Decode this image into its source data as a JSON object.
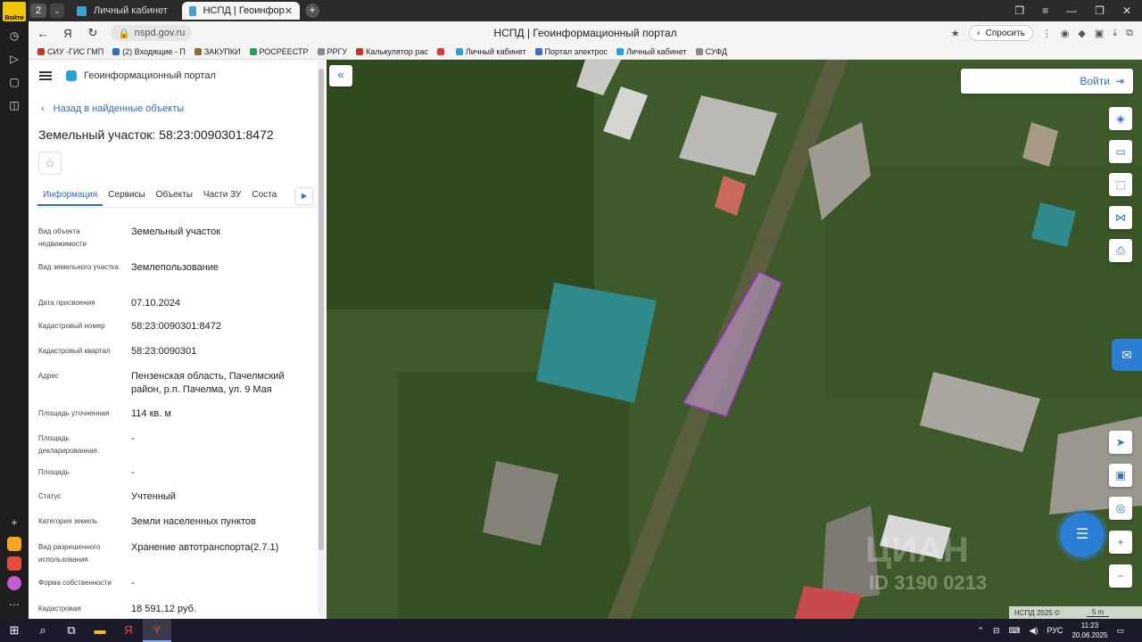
{
  "browser": {
    "rail_badge": "Войти",
    "tab_count": "2",
    "tabs": [
      {
        "label": "Личный кабинет"
      },
      {
        "label": "НСПД | Геоинформационі"
      }
    ],
    "url": "nspd.gov.ru",
    "page_title": "НСПД | Геоинформационный портал",
    "ask_label": "Спросить",
    "bookmarks": [
      {
        "label": "СИУ -ГИС ГМП",
        "color": "#c0392b"
      },
      {
        "label": "(2) Входящие - П",
        "color": "#2a6fc4"
      },
      {
        "label": "ЗАКУПКИ",
        "color": "#8e6b2e"
      },
      {
        "label": "РОСРЕЕСТР",
        "color": "#2aa060"
      },
      {
        "label": "РРГУ",
        "color": "#888888"
      },
      {
        "label": "Калькулятор рас",
        "color": "#c0392b"
      },
      {
        "label": "",
        "color": "#d83a3a"
      },
      {
        "label": "Личный кабинет",
        "color": "#2a9fd6"
      },
      {
        "label": "Портал электрос",
        "color": "#3a6fc4"
      },
      {
        "label": "Личный кабинет",
        "color": "#2a9fd6"
      },
      {
        "label": "СУФД",
        "color": "#888888"
      }
    ]
  },
  "panel": {
    "portal_name": "Геоинформационный портал",
    "back_label": "Назад в найденные объекты",
    "title": "Земельный участок: 58:23:0090301:8472",
    "tabs": [
      "Информация",
      "Сервисы",
      "Объекты",
      "Части ЗУ",
      "Соста"
    ],
    "rows": [
      {
        "label": "Вид объекта недвижимости",
        "value": "Земельный участок"
      },
      {
        "label": "Вид земельного участка",
        "value": "Землепользование"
      },
      {
        "label": "Дата присвоения",
        "value": "07.10.2024"
      },
      {
        "label": "Кадастровый номер",
        "value": "58:23:0090301:8472"
      },
      {
        "label": "Кадастровый квартал",
        "value": "58:23:0090301"
      },
      {
        "label": "Адрес",
        "value": "Пензенская область, Пачелмский район, р.п. Пачелма, ул. 9 Мая"
      },
      {
        "label": "Площадь уточненная",
        "value": "114 кв. м"
      },
      {
        "label": "Площадь декларированная",
        "value": "-"
      },
      {
        "label": "Площадь",
        "value": "-"
      },
      {
        "label": "Статус",
        "value": "Учтенный"
      },
      {
        "label": "Категория земель",
        "value": "Земли населенных пунктов"
      },
      {
        "label": "Вид разрешенного использования",
        "value": "Хранение автотранспорта(2.7.1)"
      },
      {
        "label": "Форма собственности",
        "value": "-"
      },
      {
        "label": "Кадастровая",
        "value": "18 591,12 руб."
      }
    ]
  },
  "map": {
    "login_label": "Войти",
    "attribution": "НСПД 2025 ©",
    "scale": "5 m",
    "watermark": "ЦИАН",
    "watermark_id": "ID 3190 0213"
  },
  "taskbar": {
    "lang": "РУС",
    "time": "11:23",
    "date": "20.06.2025"
  }
}
